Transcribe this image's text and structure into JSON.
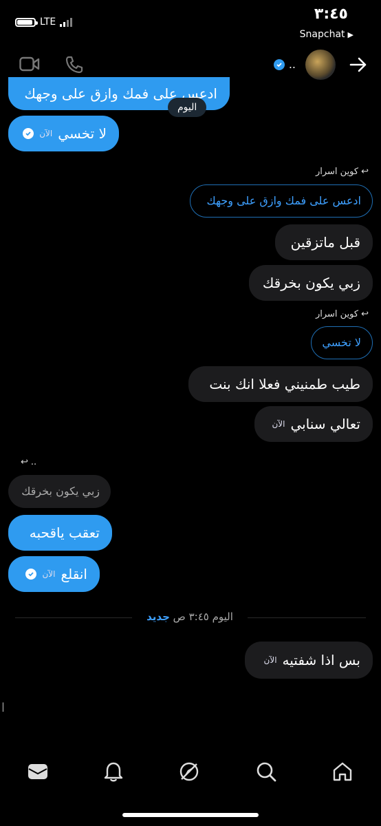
{
  "status": {
    "time": "٣:٤٥",
    "network": "LTE",
    "back_app": "Snapchat"
  },
  "header": {
    "name": ".."
  },
  "messages": {
    "m0": "ادعس على فمك وازق على وجهك",
    "day_label": "اليوم",
    "m1": "لا تخسي",
    "m1_ts": "الآن",
    "reply1_author": "كوين اسرار",
    "reply1_quote": "ادعس على فمك وازق على وجهك",
    "m2": "قبل ماتزقين",
    "m3": "زبي يكون بخرقك",
    "reply2_author": "كوين اسرار",
    "reply2_quote": "لا تخسي",
    "m4": "طيب طمنيني فعلا انك بنت",
    "m5": "تعالي سنابي",
    "m5_ts": "الآن",
    "reply3_author": "..",
    "reply3_quote": "زبي يكون بخرقك",
    "m6": "تعقب ياقحبه",
    "m7": "انقلع",
    "m7_ts": "الآن",
    "new_divider_time": "اليوم ٣:٤٥ ص",
    "new_divider_label": "جديد",
    "m8": "بس اذا شفتيه",
    "m8_ts": "الآن",
    "typing_fragment": "ا"
  },
  "colors": {
    "accent": "#2f9bf0",
    "bubble_gray": "#1c1c1e",
    "background": "#000000"
  },
  "nav": {
    "icons": [
      "inbox-icon",
      "bell-icon",
      "explore-icon",
      "search-icon",
      "home-icon"
    ]
  }
}
